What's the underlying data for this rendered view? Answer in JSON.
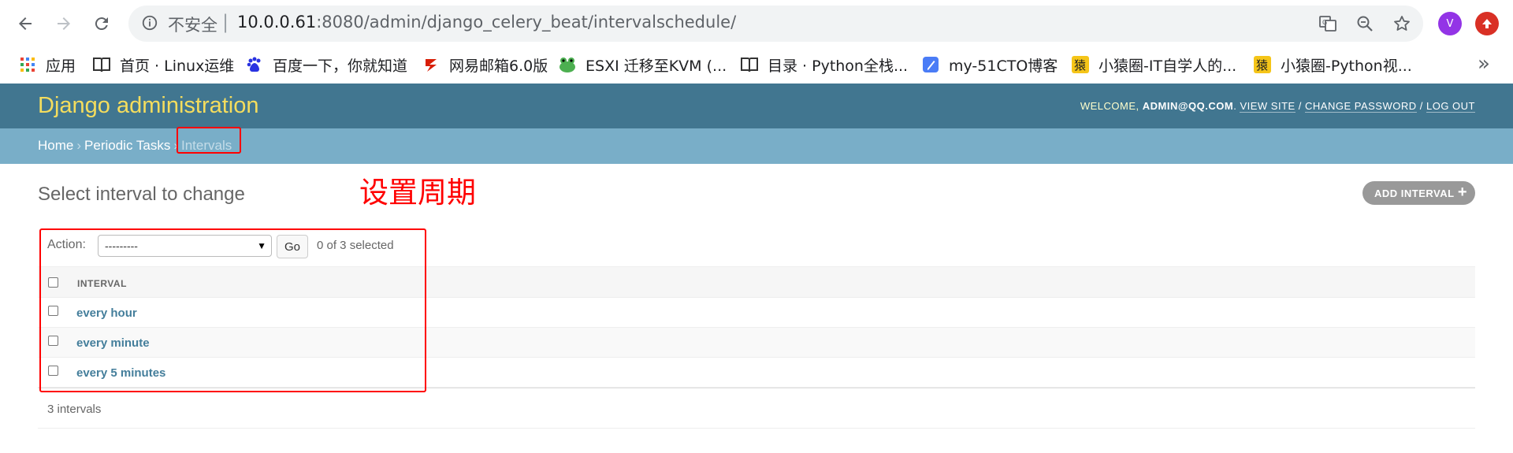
{
  "browser": {
    "security_label": "不安全",
    "url_host": "10.0.0.61",
    "url_rest": ":8080/admin/django_celery_beat/intervalschedule/",
    "avatar_letter": "V",
    "bookmarks": [
      {
        "label": "应用",
        "icon": "apps-grid-icon"
      },
      {
        "label": "首页 · Linux运维",
        "icon": "book-icon"
      },
      {
        "label": "百度一下，你就知道",
        "icon": "baidu-paw-icon"
      },
      {
        "label": "网易邮箱6.0版",
        "icon": "netease-icon"
      },
      {
        "label": "ESXI 迁移至KVM (...",
        "icon": "frog-icon"
      },
      {
        "label": "目录 · Python全栈...",
        "icon": "book-icon"
      },
      {
        "label": "my-51CTO博客",
        "icon": "pen-icon"
      },
      {
        "label": "小猿圈-IT自学人的...",
        "icon": "ape-icon"
      },
      {
        "label": "小猿圈-Python视...",
        "icon": "ape-icon"
      }
    ],
    "more": "»"
  },
  "admin": {
    "brand": "Django administration",
    "welcome": "WELCOME, ",
    "user": "ADMIN@QQ.COM",
    "view_site": "VIEW SITE",
    "change_password": "CHANGE PASSWORD",
    "log_out": "LOG OUT",
    "breadcrumbs": {
      "home": "Home",
      "section": "Periodic Tasks",
      "current": "Intervals"
    },
    "page_title": "Select interval to change",
    "annotation": "设置周期",
    "add_button": "ADD INTERVAL",
    "actions": {
      "label": "Action:",
      "selected_value": "---------",
      "go": "Go",
      "counter": "0 of 3 selected"
    },
    "table": {
      "column_header": "INTERVAL",
      "rows": [
        "every hour",
        "every minute",
        "every 5 minutes"
      ]
    },
    "paginator": "3 intervals"
  },
  "colors": {
    "header_bg": "#417690",
    "breadcrumb_bg": "#79aec8",
    "brand_text": "#f5dd5d",
    "link": "#447e9b",
    "annotation_red": "#ff0000"
  }
}
